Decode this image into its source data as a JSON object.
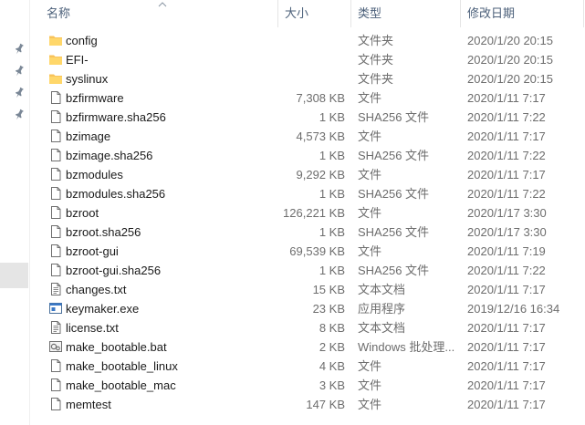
{
  "columns": {
    "name": "名称",
    "size": "大小",
    "type": "类型",
    "modified": "修改日期"
  },
  "files": [
    {
      "name": "config",
      "size": "",
      "type": "文件夹",
      "modified": "2020/1/20 20:15",
      "icon": "folder-icon"
    },
    {
      "name": "EFI-",
      "size": "",
      "type": "文件夹",
      "modified": "2020/1/20 20:15",
      "icon": "folder-icon"
    },
    {
      "name": "syslinux",
      "size": "",
      "type": "文件夹",
      "modified": "2020/1/20 20:15",
      "icon": "folder-icon"
    },
    {
      "name": "bzfirmware",
      "size": "7,308 KB",
      "type": "文件",
      "modified": "2020/1/11 7:17",
      "icon": "file-icon"
    },
    {
      "name": "bzfirmware.sha256",
      "size": "1 KB",
      "type": "SHA256 文件",
      "modified": "2020/1/11 7:22",
      "icon": "file-icon"
    },
    {
      "name": "bzimage",
      "size": "4,573 KB",
      "type": "文件",
      "modified": "2020/1/11 7:17",
      "icon": "file-icon"
    },
    {
      "name": "bzimage.sha256",
      "size": "1 KB",
      "type": "SHA256 文件",
      "modified": "2020/1/11 7:22",
      "icon": "file-icon"
    },
    {
      "name": "bzmodules",
      "size": "9,292 KB",
      "type": "文件",
      "modified": "2020/1/11 7:17",
      "icon": "file-icon"
    },
    {
      "name": "bzmodules.sha256",
      "size": "1 KB",
      "type": "SHA256 文件",
      "modified": "2020/1/11 7:22",
      "icon": "file-icon"
    },
    {
      "name": "bzroot",
      "size": "126,221 KB",
      "type": "文件",
      "modified": "2020/1/17 3:30",
      "icon": "file-icon"
    },
    {
      "name": "bzroot.sha256",
      "size": "1 KB",
      "type": "SHA256 文件",
      "modified": "2020/1/17 3:30",
      "icon": "file-icon"
    },
    {
      "name": "bzroot-gui",
      "size": "69,539 KB",
      "type": "文件",
      "modified": "2020/1/11 7:19",
      "icon": "file-icon"
    },
    {
      "name": "bzroot-gui.sha256",
      "size": "1 KB",
      "type": "SHA256 文件",
      "modified": "2020/1/11 7:22",
      "icon": "file-icon"
    },
    {
      "name": "changes.txt",
      "size": "15 KB",
      "type": "文本文档",
      "modified": "2020/1/11 7:17",
      "icon": "text-file-icon"
    },
    {
      "name": "keymaker.exe",
      "size": "23 KB",
      "type": "应用程序",
      "modified": "2019/12/16 16:34",
      "icon": "application-icon"
    },
    {
      "name": "license.txt",
      "size": "8 KB",
      "type": "文本文档",
      "modified": "2020/1/11 7:17",
      "icon": "text-file-icon"
    },
    {
      "name": "make_bootable.bat",
      "size": "2 KB",
      "type": "Windows 批处理...",
      "modified": "2020/1/11 7:17",
      "icon": "batch-file-icon"
    },
    {
      "name": "make_bootable_linux",
      "size": "4 KB",
      "type": "文件",
      "modified": "2020/1/11 7:17",
      "icon": "file-icon"
    },
    {
      "name": "make_bootable_mac",
      "size": "3 KB",
      "type": "文件",
      "modified": "2020/1/11 7:17",
      "icon": "file-icon"
    },
    {
      "name": "memtest",
      "size": "147 KB",
      "type": "文件",
      "modified": "2020/1/11 7:17",
      "icon": "file-icon"
    }
  ]
}
